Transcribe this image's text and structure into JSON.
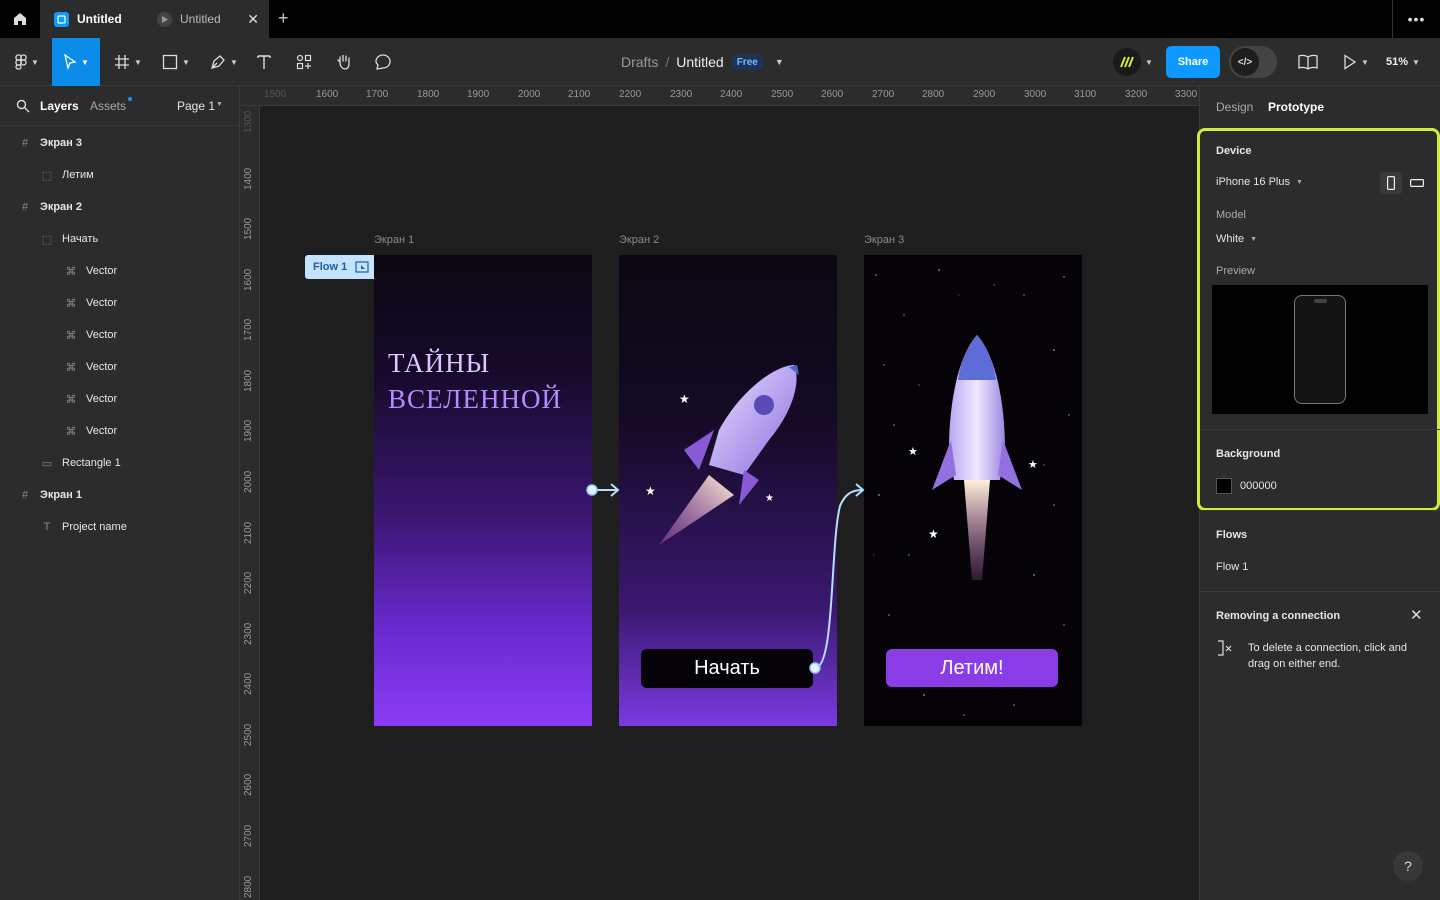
{
  "tabs": [
    {
      "label": "Untitled",
      "active": true
    },
    {
      "label": "Untitled",
      "active": false
    }
  ],
  "toolbar": {
    "breadcrumb_root": "Drafts",
    "breadcrumb_sep": "/",
    "file_name": "Untitled",
    "plan_badge": "Free",
    "share_label": "Share",
    "zoom": "51%"
  },
  "left_panel": {
    "tab_layers": "Layers",
    "tab_assets": "Assets",
    "page_label": "Page 1",
    "layers": [
      {
        "name": "Экран 3",
        "icon": "frame-icon",
        "bold": true
      },
      {
        "name": "Летим",
        "icon": "group-icon",
        "bold": false
      },
      {
        "name": "Экран 2",
        "icon": "frame-icon",
        "bold": true
      },
      {
        "name": "Начать",
        "icon": "group-icon",
        "bold": false
      },
      {
        "name": "Vector",
        "icon": "vector-icon",
        "bold": false
      },
      {
        "name": "Vector",
        "icon": "vector-icon",
        "bold": false
      },
      {
        "name": "Vector",
        "icon": "vector-icon",
        "bold": false
      },
      {
        "name": "Vector",
        "icon": "vector-icon",
        "bold": false
      },
      {
        "name": "Vector",
        "icon": "vector-icon",
        "bold": false
      },
      {
        "name": "Vector",
        "icon": "vector-icon",
        "bold": false
      },
      {
        "name": "Rectangle 1",
        "icon": "rectangle-icon",
        "bold": false
      },
      {
        "name": "Экран 1",
        "icon": "frame-icon",
        "bold": true
      },
      {
        "name": "Project name",
        "icon": "text-icon",
        "bold": false
      }
    ]
  },
  "rulers": {
    "top": [
      "1500",
      "1600",
      "1700",
      "1800",
      "1900",
      "2000",
      "2100",
      "2200",
      "2300",
      "2400",
      "2500",
      "2600",
      "2700",
      "2800",
      "2900",
      "3000",
      "3100",
      "3200",
      "3300"
    ],
    "left": [
      "1300",
      "1400",
      "1500",
      "1600",
      "1700",
      "1800",
      "1900",
      "2000",
      "2100",
      "2200",
      "2300",
      "2400",
      "2500",
      "2600",
      "2700",
      "2800"
    ]
  },
  "canvas": {
    "flow_badge": "Flow 1",
    "frames": [
      {
        "label": "Экран 1",
        "title_line1": "ТАЙНЫ",
        "title_line2": "ВСЕЛЕННОЙ"
      },
      {
        "label": "Экран 2",
        "button": "Начать"
      },
      {
        "label": "Экран 3",
        "button": "Летим!"
      }
    ]
  },
  "right_panel": {
    "tab_design": "Design",
    "tab_prototype": "Prototype",
    "device_heading": "Device",
    "device_value": "iPhone 16 Plus",
    "model_label": "Model",
    "model_value": "White",
    "preview_label": "Preview",
    "background_heading": "Background",
    "background_value": "000000",
    "flows_heading": "Flows",
    "flow_item": "Flow 1",
    "removing_heading": "Removing a connection",
    "removing_text_1": "To delete a connection, click and",
    "removing_text_2": "drag on either end.",
    "help": "?"
  },
  "colors": {
    "accent": "#0d99ff",
    "highlight": "#c9ef3a",
    "button_purple": "#8a3ce6"
  }
}
